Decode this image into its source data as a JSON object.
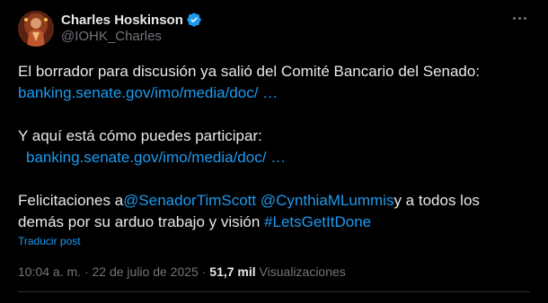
{
  "author": {
    "display_name": "Charles Hoskinson",
    "handle": "@IOHK_Charles",
    "verified_color": "#1d9bf0"
  },
  "more_icon": "more-horizontal-icon",
  "tweet": {
    "line1": "El borrador para discusión ya salió del Comité Bancario del Senado:",
    "link1": "banking.senate.gov/imo/media/doc/ …",
    "line2": "Y aquí está cómo puedes participar:",
    "link2": "banking.senate.gov/imo/media/doc/ …",
    "line3_prefix": "Felicitaciones a",
    "mention1": "@SenadorTimScott",
    "mention2": "@CynthiaMLummis",
    "line3_suffix": "y a todos los",
    "line4_prefix": "demás por su arduo trabajo y visión ",
    "hashtag": "#LetsGetItDone"
  },
  "translate_label": "Traducir post",
  "meta": {
    "time": "10:04 a. m.",
    "sep1": "·",
    "date": "22 de julio de 2025",
    "sep2": "·",
    "views_count": "51,7 mil",
    "views_label": "Visualizaciones"
  },
  "colors": {
    "background": "#000000",
    "text": "#e7e9ea",
    "secondary": "#71767b",
    "link": "#1d9bf0",
    "divider": "#2f3336"
  }
}
